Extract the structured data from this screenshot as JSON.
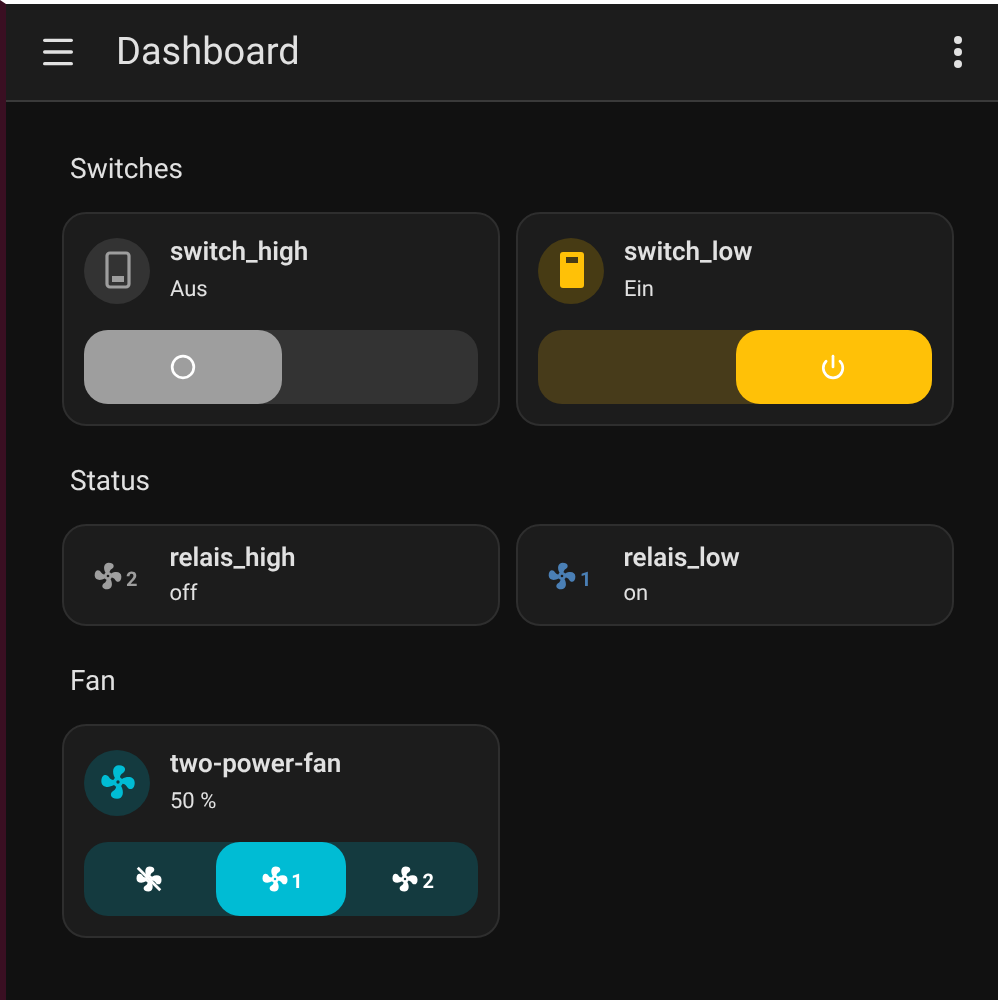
{
  "header": {
    "title": "Dashboard"
  },
  "sections": [
    {
      "title": "Switches",
      "kind": "switches",
      "items": [
        {
          "name": "switch_high",
          "state": "Aus",
          "on": false
        },
        {
          "name": "switch_low",
          "state": "Ein",
          "on": true
        }
      ]
    },
    {
      "title": "Status",
      "kind": "status",
      "items": [
        {
          "name": "relais_high",
          "state": "off",
          "on": false,
          "speed_label": "2"
        },
        {
          "name": "relais_low",
          "state": "on",
          "on": true,
          "speed_label": "1"
        }
      ]
    },
    {
      "title": "Fan",
      "kind": "fan",
      "items": [
        {
          "name": "two-power-fan",
          "state": "50 %",
          "on": true,
          "modes": [
            {
              "kind": "off",
              "selected": false
            },
            {
              "kind": "speed",
              "speed_label": "1",
              "selected": true
            },
            {
              "kind": "speed",
              "speed_label": "2",
              "selected": false
            }
          ]
        }
      ]
    }
  ]
}
